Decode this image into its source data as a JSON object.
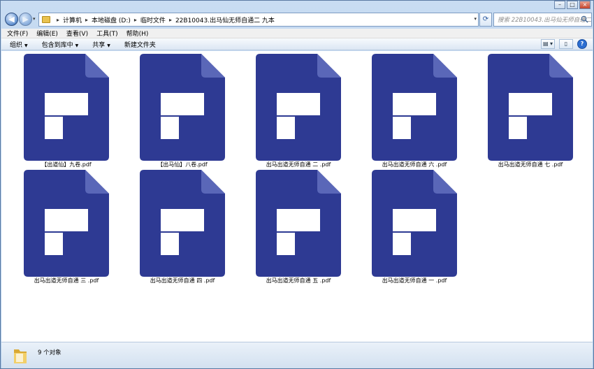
{
  "address_bar": {
    "crumbs": [
      "计算机",
      "本地磁盘 (D:)",
      "临时文件",
      "22B10043.出马仙无师自通二  九本"
    ]
  },
  "search": {
    "placeholder": "搜索 22B10043.出马仙无师自通二..."
  },
  "menubar": {
    "file": "文件(F)",
    "edit": "编辑(E)",
    "view": "查看(V)",
    "tools": "工具(T)",
    "help": "帮助(H)"
  },
  "toolbar": {
    "organize": "组织",
    "include_in_library": "包含到库中",
    "share": "共享",
    "new_folder": "新建文件夹"
  },
  "files": [
    {
      "name": "【出道仙】九卷.pdf"
    },
    {
      "name": "【出马仙】八卷.pdf"
    },
    {
      "name": "出马出道无师自通  二  .pdf"
    },
    {
      "name": "出马出道无师自通  六  .pdf"
    },
    {
      "name": "出马出道无师自通  七  .pdf"
    },
    {
      "name": "出马出道无师自通  三  .pdf"
    },
    {
      "name": "出马出道无师自通  四  .pdf"
    },
    {
      "name": "出马出道无师自通  五  .pdf"
    },
    {
      "name": "出马出道无师自通  一 .pdf"
    }
  ],
  "status": {
    "count_text": "9 个对象"
  },
  "colors": {
    "pdf_body": "#2e3a93",
    "pdf_fold": "#5a67b8",
    "window_frame": "#bcd6ef"
  },
  "icons": {
    "file_icon": "pdf-file-icon",
    "folder_icon": "folder-icon"
  }
}
